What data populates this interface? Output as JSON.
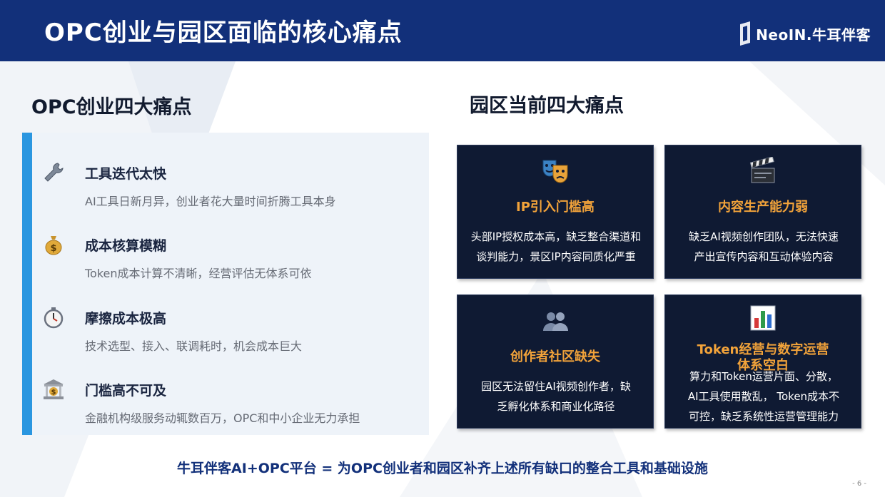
{
  "header": {
    "title": "OPC创业与园区面临的核心痛点",
    "logo_text": "NeoIN.牛耳伴客",
    "bg_color": "#12307a"
  },
  "left": {
    "title": "OPC创业四大痛点",
    "accent_color": "#2a96e0",
    "items": [
      {
        "icon": "wrench-icon",
        "title": "工具迭代太快",
        "desc": "AI工具日新月异，创业者花大量时间折腾工具本身"
      },
      {
        "icon": "money-bag-icon",
        "title": "成本核算模糊",
        "desc": "Token成本计算不清晰，经营评估无体系可依"
      },
      {
        "icon": "stopwatch-icon",
        "title": "摩擦成本极高",
        "desc": "技术选型、接入、联调耗时，机会成本巨大"
      },
      {
        "icon": "bank-icon",
        "title": "门槛高不可及",
        "desc": "金融机构级服务动辄数百万，OPC和中小企业无力承担"
      }
    ]
  },
  "right": {
    "title": "园区当前四大痛点",
    "card_color": "#0f1a33",
    "title_color": "#f2a33a",
    "cards": [
      {
        "icon": "theater-masks-icon",
        "title": "IP引入门槛高",
        "desc_lines": [
          "头部IP授权成本高，缺乏整合渠道和",
          "谈判能力，景区IP内容同质化严重"
        ]
      },
      {
        "icon": "clapperboard-icon",
        "title": "内容生产能力弱",
        "desc_lines": [
          "缺乏AI视频创作团队，无法快速",
          "产出宣传内容和互动体验内容"
        ]
      },
      {
        "icon": "people-icon",
        "title": "创作者社区缺失",
        "desc_lines": [
          "园区无法留住AI视频创作者，缺",
          "乏孵化体系和商业化路径"
        ]
      },
      {
        "icon": "bar-chart-icon",
        "title_lines": [
          "Token经营与数字运营",
          "体系空白"
        ],
        "desc_lines": [
          "算力和Token运营片面、分散，",
          "AI工具使用散乱， Token成本不",
          "可控，缺乏系统性运营管理能力"
        ]
      }
    ]
  },
  "footer": {
    "tagline": "牛耳伴客AI+OPC平台 = 为OPC创业者和园区补齐上述所有缺口的整合工具和基础设施",
    "page_number": "- 6 -"
  }
}
